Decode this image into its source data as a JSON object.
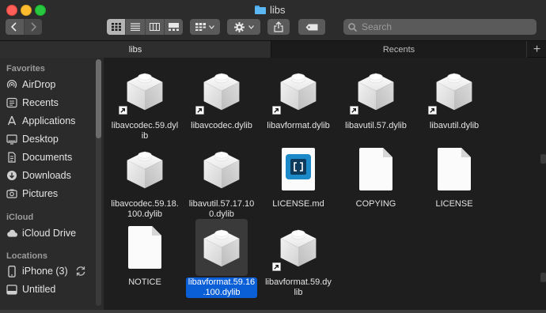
{
  "window": {
    "title": "libs"
  },
  "toolbar": {
    "search_placeholder": "Search",
    "view_modes": [
      "icon-view-icon",
      "list-view-icon",
      "column-view-icon",
      "gallery-view-icon"
    ]
  },
  "tabs": [
    {
      "label": "libs",
      "active": true
    },
    {
      "label": "Recents",
      "active": false
    }
  ],
  "sidebar": {
    "favorites_header": "Favorites",
    "favorites": [
      {
        "label": "AirDrop",
        "icon": "airdrop-icon"
      },
      {
        "label": "Recents",
        "icon": "recents-icon"
      },
      {
        "label": "Applications",
        "icon": "applications-icon"
      },
      {
        "label": "Desktop",
        "icon": "desktop-icon"
      },
      {
        "label": "Documents",
        "icon": "documents-icon"
      },
      {
        "label": "Downloads",
        "icon": "downloads-icon"
      },
      {
        "label": "Pictures",
        "icon": "pictures-icon"
      }
    ],
    "icloud_header": "iCloud",
    "icloud": [
      {
        "label": "iCloud Drive",
        "icon": "cloud-icon"
      }
    ],
    "locations_header": "Locations",
    "locations": [
      {
        "label": "iPhone (3)",
        "icon": "phone-icon"
      },
      {
        "label": "Untitled",
        "icon": "disk-icon"
      }
    ]
  },
  "files": [
    {
      "name": "libavcodec.59.dylib",
      "kind": "dylib",
      "alias": true
    },
    {
      "name": "libavcodec.dylib",
      "kind": "dylib",
      "alias": true
    },
    {
      "name": "libavformat.dylib",
      "kind": "dylib",
      "alias": true
    },
    {
      "name": "libavutil.57.dylib",
      "kind": "dylib",
      "alias": true
    },
    {
      "name": "libavutil.dylib",
      "kind": "dylib",
      "alias": true
    },
    {
      "name": "libavcodec.59.18.100.dylib",
      "kind": "dylib",
      "alias": false
    },
    {
      "name": "libavutil.57.17.100.dylib",
      "kind": "dylib",
      "alias": false
    },
    {
      "name": "LICENSE.md",
      "kind": "md",
      "alias": false
    },
    {
      "name": "COPYING",
      "kind": "doc",
      "alias": false
    },
    {
      "name": "LICENSE",
      "kind": "doc",
      "alias": false
    },
    {
      "name": "NOTICE",
      "kind": "doc",
      "alias": false
    },
    {
      "name": "libavformat.59.16.100.dylib",
      "kind": "dylib",
      "alias": false,
      "selected": true
    },
    {
      "name": "libavformat.59.dylib",
      "kind": "dylib",
      "alias": true
    }
  ]
}
